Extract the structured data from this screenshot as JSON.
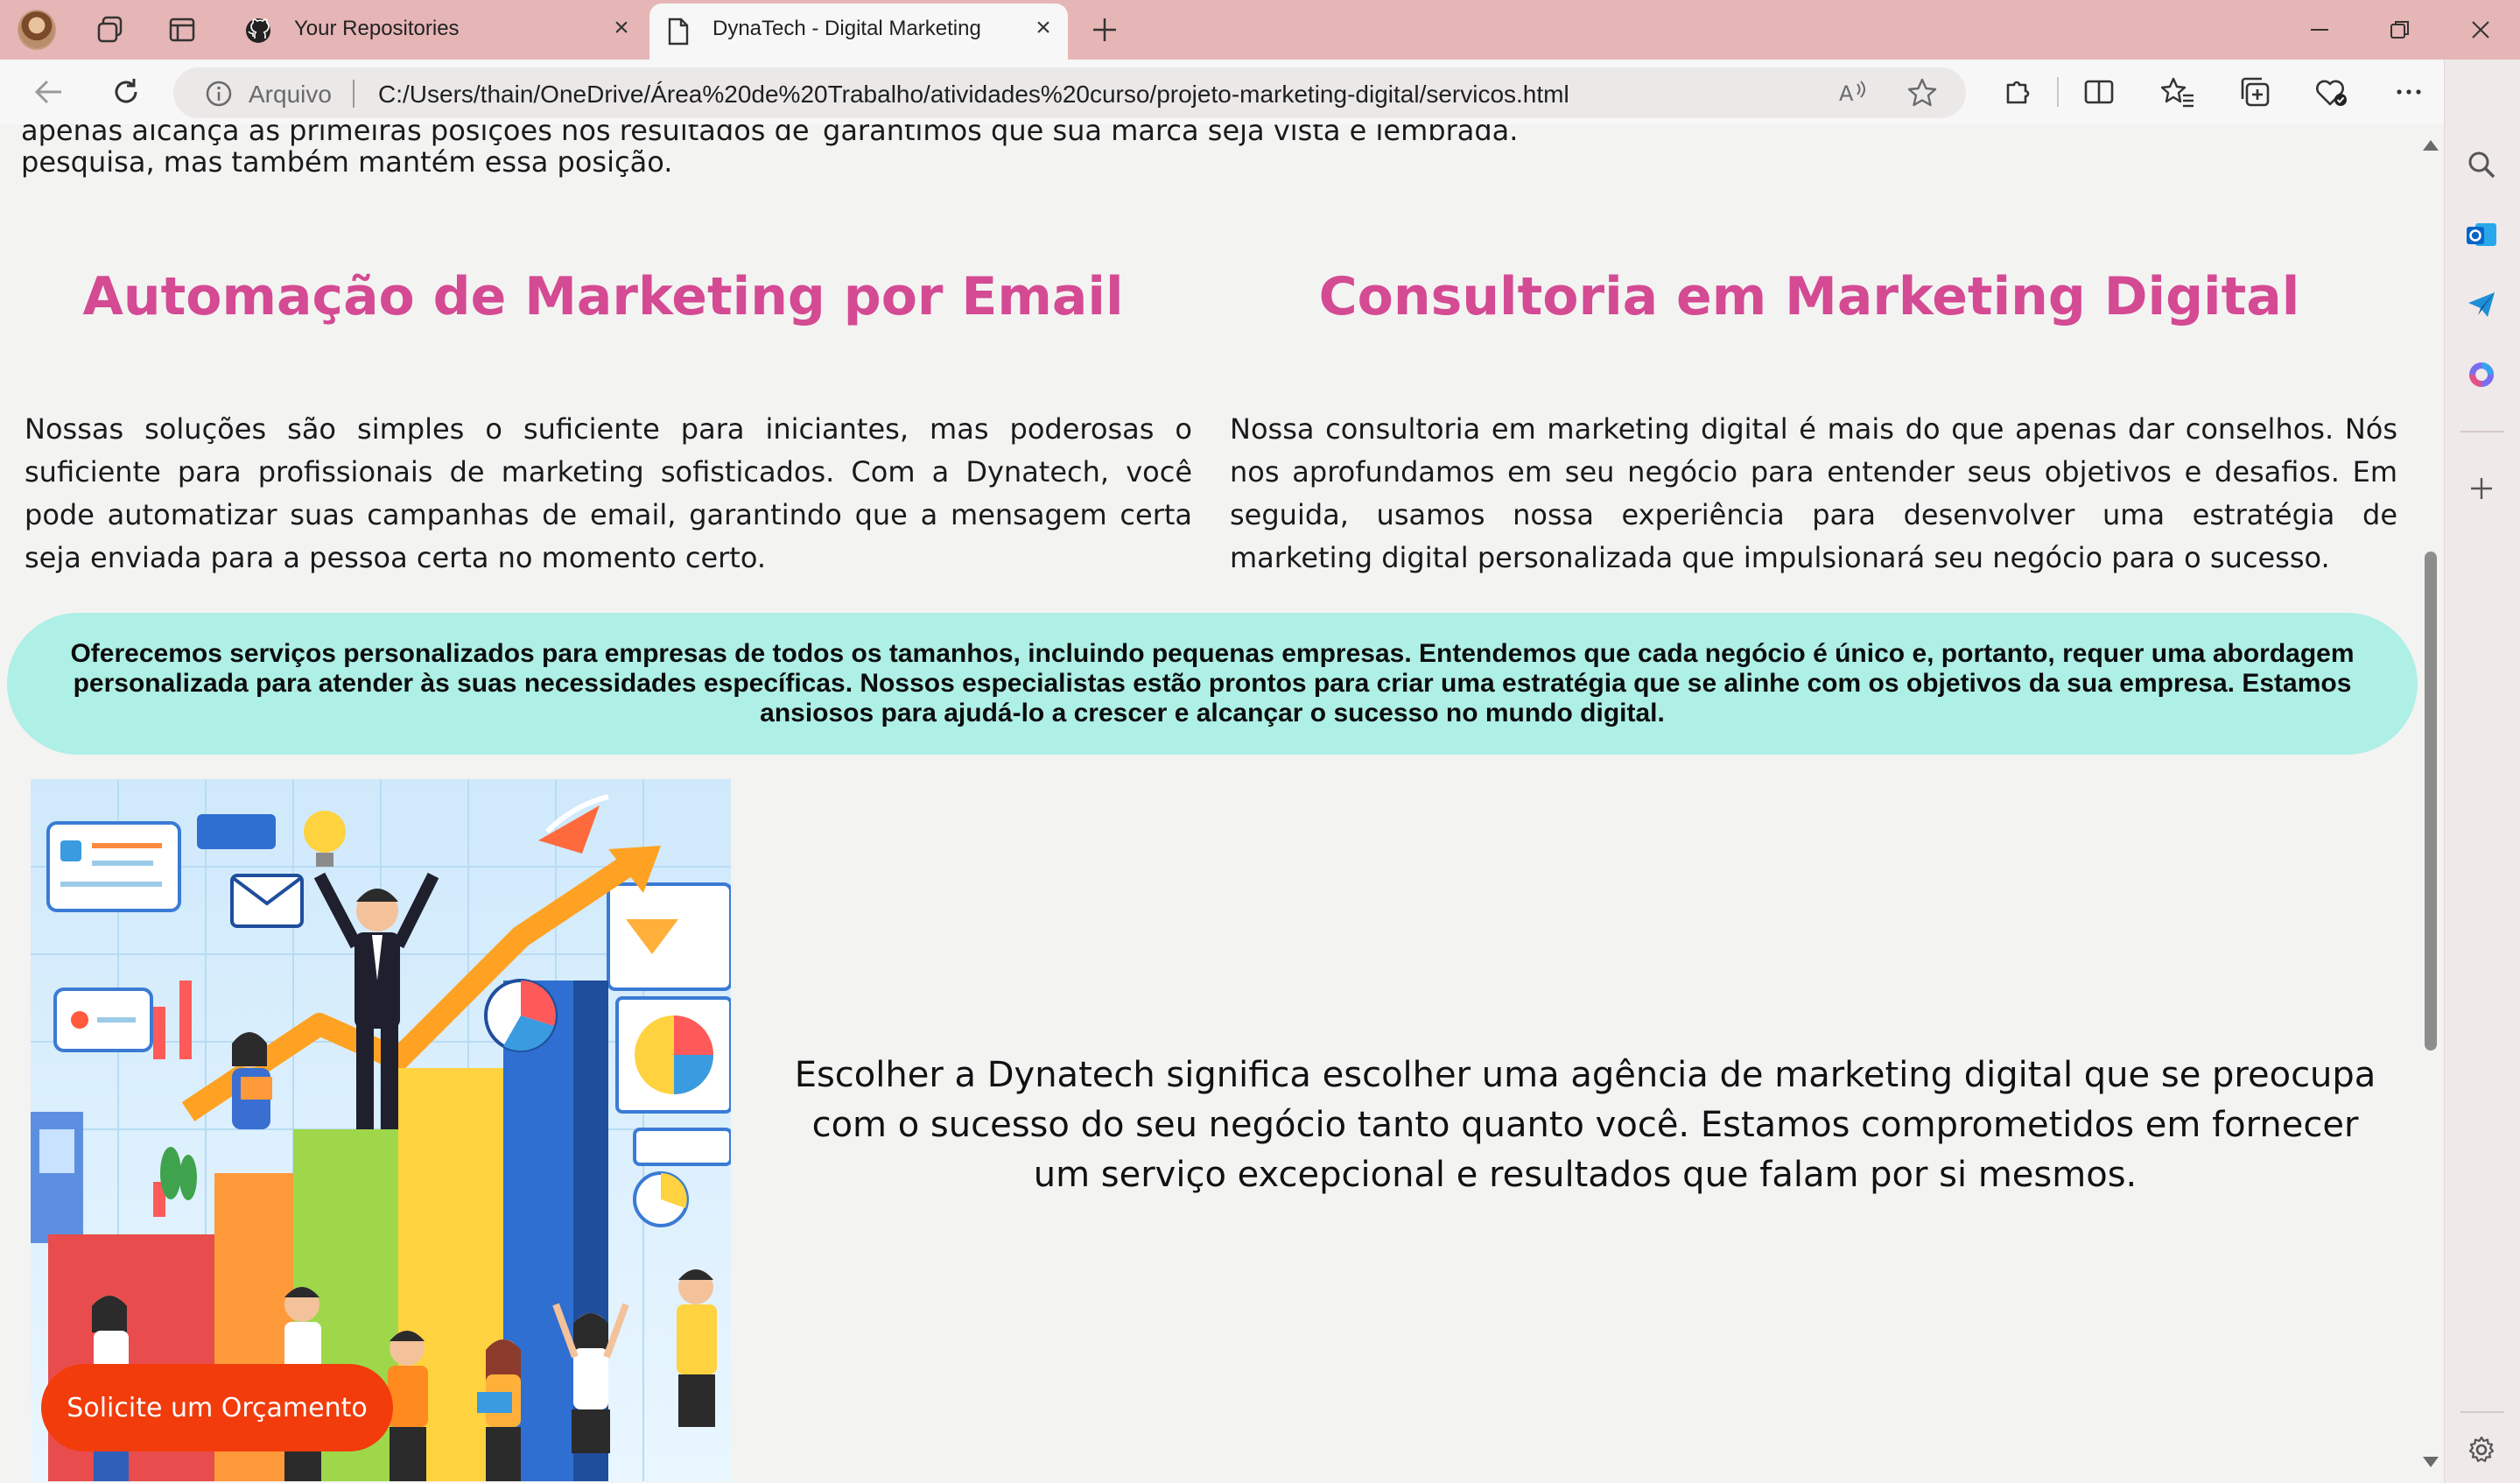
{
  "browser": {
    "tabs": [
      {
        "title": "Your Repositories",
        "icon": "github-icon",
        "active": false
      },
      {
        "title": "DynaTech - Digital Marketing",
        "icon": "page-icon",
        "active": true
      }
    ],
    "address": {
      "label": "Arquivo",
      "url": "C:/Users/thain/OneDrive/Área%20de%20Trabalho/atividades%20curso/projeto-marketing-digital/servicos.html"
    },
    "accent_color": "#e6b5b5"
  },
  "page": {
    "cut_text_left": "apenas alcança as primeiras posições nos resultados de",
    "cut_text_right": "garantimos que sua marca seja vista e lembrada.",
    "cut_text_left_last": "pesquisa, mas também mantém essa posição.",
    "services": [
      {
        "title": "Automação de Marketing por Email",
        "text": "Nossas soluções são simples o suficiente para iniciantes, mas poderosas o suficiente para profissionais de marketing sofisticados. Com a Dynatech, você pode automatizar suas campanhas de email, garantindo que a mensagem certa seja enviada para a pessoa certa no momento certo."
      },
      {
        "title": "Consultoria em Marketing Digital",
        "text": "Nossa consultoria em marketing digital é mais do que apenas dar conselhos. Nós nos aprofundamos em seu negócio para entender seus objetivos e desafios. Em seguida, usamos nossa experiência para desenvolver uma estratégia de marketing digital personalizada que impulsionará seu negócio para o sucesso."
      }
    ],
    "banner": "Oferecemos serviços personalizados para empresas de todos os tamanhos, incluindo pequenas empresas. Entendemos que cada negócio é único e, portanto, requer uma abordagem personalizada para atender às suas necessidades específicas. Nossos especialistas estão prontos para criar uma estratégia que se alinhe com os objetivos da sua empresa. Estamos ansiosos para ajudá-lo a crescer e alcançar o sucesso no mundo digital.",
    "closing": "Escolher a Dynatech significa escolher uma agência de marketing digital que se preocupa com o sucesso do seu negócio tanto quanto você. Estamos comprometidos em fornecer um serviço excepcional e resultados que falam por si mesmos.",
    "cta": "Solicite um Orçamento",
    "colors": {
      "title": "#d44a93",
      "banner": "#aeefe6",
      "cta": "#f23c0c"
    }
  }
}
